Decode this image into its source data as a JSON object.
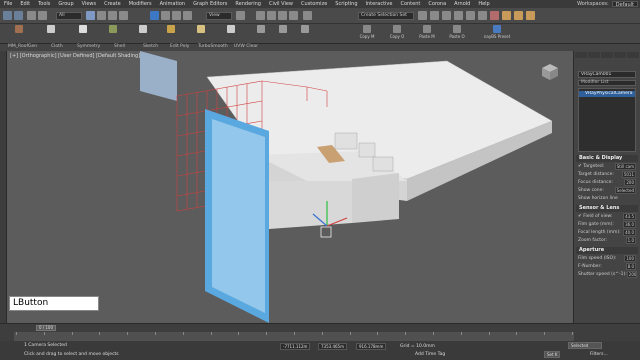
{
  "menubar": {
    "items": [
      "File",
      "Edit",
      "Tools",
      "Group",
      "Views",
      "Create",
      "Modifiers",
      "Animation",
      "Graph Editors",
      "Rendering",
      "Civil View",
      "Customize",
      "Scripting",
      "Interactive",
      "Content",
      "Corona",
      "Arnold",
      "Help"
    ],
    "workspace_label": "Workspaces:",
    "workspace_value": "Default"
  },
  "toolbar": {
    "filter_value": "All",
    "view_value": "View",
    "selection_set_placeholder": "Create Selection Set"
  },
  "ribbon": {
    "items": [
      "Copy M",
      "Copy O",
      "Paste M",
      "Paste O",
      "nayBS Preset"
    ],
    "sub_items": [
      "MM_RoofGen",
      "Cloth",
      "Symmetry",
      "Shell",
      "Sketch",
      "Edit Poly",
      "TurboSmooth",
      "UVW Clear"
    ]
  },
  "viewport": {
    "label": "[+] [Orthographic] [User Defined] [Default Shading]",
    "lbutton_text": "LButton"
  },
  "command_panel": {
    "object_name": "VRayCam001",
    "modifier_list": "Modifier List",
    "stack_item": "VRayPhysicalCamera",
    "rollouts": [
      {
        "title": "Basic & Display",
        "rows": [
          {
            "label": "✔ Targeted:",
            "value": "Still cam"
          },
          {
            "label": "Target distance:",
            "value": "5011"
          },
          {
            "label": "Focus distance:",
            "value": "200"
          },
          {
            "label": "Show cone:",
            "value": "Selected"
          },
          {
            "label": "Show horizon line",
            "value": ""
          }
        ]
      },
      {
        "title": "Sensor & Lens",
        "rows": [
          {
            "label": "✔ Field of view:",
            "value": "43.5"
          },
          {
            "label": "Film gate (mm):",
            "value": "36.0"
          },
          {
            "label": "Focal length (mm):",
            "value": "40.0"
          },
          {
            "label": "Zoom factor:",
            "value": "1.0"
          }
        ]
      },
      {
        "title": "Aperture",
        "rows": [
          {
            "label": "Film speed (ISO):",
            "value": "100"
          },
          {
            "label": "F-Number:",
            "value": "8.0"
          },
          {
            "label": "Shutter speed (s^-1):",
            "value": "200"
          }
        ]
      }
    ]
  },
  "timeline": {
    "frame_display": "0 / 100",
    "ticks": [
      "0",
      "5",
      "10",
      "15",
      "20",
      "25",
      "30",
      "35",
      "40",
      "45",
      "50",
      "55",
      "60",
      "65",
      "70",
      "75",
      "80",
      "85",
      "90",
      "95",
      "100"
    ]
  },
  "statusbar": {
    "selection_text": "1 Camera Selected",
    "prompt_text": "Click and drag to select and move objects",
    "x": "-7711.112m",
    "y": "7353.465m",
    "z": "916.178mm",
    "grid": "Grid = 10.0mm",
    "add_time_tag": "Add Time Tag",
    "selected": "Selected",
    "set_key": "Set K",
    "filters": "Filters..."
  }
}
